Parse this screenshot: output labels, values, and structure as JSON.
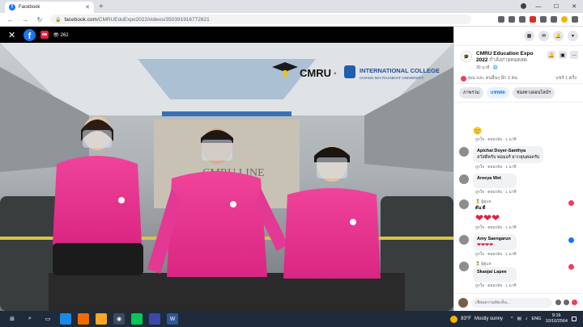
{
  "browser": {
    "tab_title": "Facebook",
    "new_tab_label": "+",
    "url_host": "facebook.com",
    "url_path": "/CMRUEduExpo2022/videos/350391916772821"
  },
  "video": {
    "live_badge": "สด",
    "viewer_count": "262",
    "brand_cmru": "CMRU",
    "brand_x": "×",
    "college_name": "INTERNATIONAL COLLEGE",
    "college_sub": "CHIANG MAI RAJABHAT UNIVERSITY",
    "backdrop_text": "CMRU LINE"
  },
  "sidebar": {
    "page_name": "CMRU Education Expo 2022",
    "live_word": "กำลังถ่ายทอดสด",
    "page_meta": "30 นาที · 🌐",
    "reactions_text": "คุณ และ คนอื่นๆ อีก 3 คน",
    "shares_text": "แชร์ 1 ครั้ง",
    "tabs": [
      {
        "label": "ภาพรวม"
      },
      {
        "label": "แชทสด"
      },
      {
        "label": "ช่องทางออนไลน์ฯ"
      }
    ],
    "comments": [
      {
        "name": "",
        "text": "",
        "emoji": "🙂",
        "actions": "ถูกใจ · ตอบกลับ · 1 นาที"
      },
      {
        "name": "Apichai Doyer-Santhya",
        "text": "สวัสดีครับ พ่อมอร์ ยากหุนต่อครับ",
        "actions": "ถูกใจ · ตอบกลับ · 1 นาที"
      },
      {
        "name": "Areeya Wet",
        "text": "",
        "actions": "ถูกใจ · ตอบกลับ · 1 นาที"
      },
      {
        "tag": "🏅 ผู้ดูแล",
        "name": "ต้น ดี",
        "hearts": "❤❤❤",
        "actions": "ถูกใจ · ตอบกลับ · 1 นาที"
      },
      {
        "name": "Amy Saengarun",
        "hearts": "❤❤❤❤",
        "actions": "ถูกใจ · ตอบกลับ · 1 นาที"
      },
      {
        "tag": "🏅 ผู้ดูแล",
        "name": "Skaojai Lapee",
        "text": "",
        "actions": "ถูกใจ · ตอบกลับ · 1 นาที"
      }
    ],
    "comment_placeholder": "เขียนความคิดเห็น..."
  },
  "taskbar": {
    "weather_temp": "83°F",
    "weather_desc": "Mostly sunny",
    "time": "9:16",
    "date": "10/10/2564",
    "lang": "ENG"
  }
}
